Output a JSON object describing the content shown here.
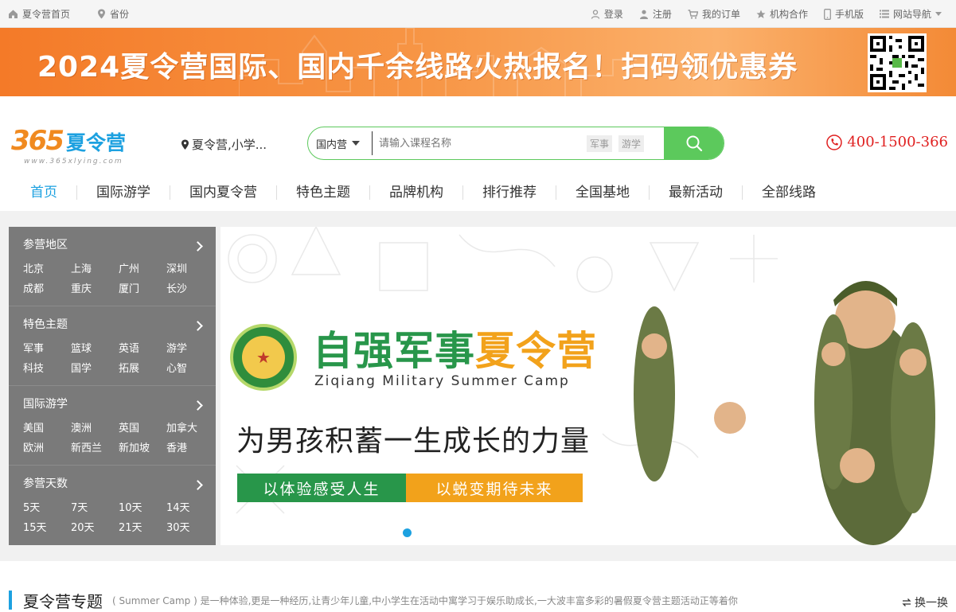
{
  "topbar": {
    "home": "夏令营首页",
    "province": "省份",
    "links": [
      {
        "label": "登录",
        "icon": "user-icon"
      },
      {
        "label": "注册",
        "icon": "person-icon"
      },
      {
        "label": "我的订单",
        "icon": "cart-icon"
      },
      {
        "label": "机构合作",
        "icon": "star-icon"
      },
      {
        "label": "手机版",
        "icon": "phone-icon"
      },
      {
        "label": "网站导航",
        "icon": "list-icon"
      }
    ]
  },
  "banner": {
    "headline": "2024夏令营国际、国内千余线路火热报名！扫码领优惠券"
  },
  "logo": {
    "brand_digits": "365",
    "brand_cn": "夏令营",
    "url": "www.365xlying.com"
  },
  "location": "夏令营,小学...",
  "search": {
    "category": "国内营",
    "placeholder": "请输入课程名称",
    "tags": [
      "军事",
      "游学"
    ]
  },
  "phone": "400-1500-366",
  "nav": [
    "首页",
    "国际游学",
    "国内夏令营",
    "特色主题",
    "品牌机构",
    "排行推荐",
    "全国基地",
    "最新活动",
    "全部线路"
  ],
  "sidebar": [
    {
      "title": "参营地区",
      "items": [
        "北京",
        "上海",
        "广州",
        "深圳",
        "成都",
        "重庆",
        "厦门",
        "长沙"
      ]
    },
    {
      "title": "特色主题",
      "items": [
        "军事",
        "篮球",
        "英语",
        "游学",
        "科技",
        "国学",
        "拓展",
        "心智"
      ]
    },
    {
      "title": "国际游学",
      "items": [
        "美国",
        "澳洲",
        "英国",
        "加拿大",
        "欧洲",
        "新西兰",
        "新加坡",
        "香港"
      ]
    },
    {
      "title": "参营天数",
      "items": [
        "5天",
        "7天",
        "10天",
        "14天",
        "15天",
        "20天",
        "21天",
        "30天"
      ]
    }
  ],
  "hero": {
    "title_green": "自强军事",
    "title_orange": "夏令营",
    "subtitle_en": "Ziqiang Military Summer Camp",
    "slogan": "为男孩积蓄一生成长的力量",
    "pill_left": "以体验感受人生",
    "pill_right": "以蜕变期待未来"
  },
  "section": {
    "title": "夏令营专题",
    "desc": "( Summer Camp ) 是一种体验,更是一种经历,让青少年儿童,中小学生在活动中寓学习于娱乐助成长,一大波丰富多彩的暑假夏令营主题活动正等着你",
    "swap": "换一换"
  },
  "colors": {
    "accent_blue": "#1da1e0",
    "accent_green": "#5cc95c",
    "banner_orange": "#f47a28",
    "phone_red": "#e02020"
  }
}
